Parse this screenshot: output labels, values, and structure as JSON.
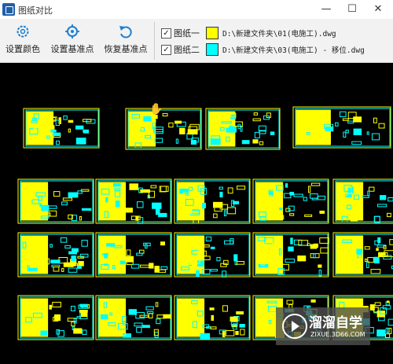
{
  "window": {
    "title": "图纸对比",
    "minimize": "—",
    "maximize": "☐",
    "close": "✕"
  },
  "toolbar": {
    "set_color": "设置颜色",
    "set_base": "设置基准点",
    "restore_base": "恢复基准点"
  },
  "drawings": [
    {
      "label": "图纸一",
      "checked": true,
      "color": "#ffff00",
      "path": "D:\\新建文件夹\\01(电施工).dwg"
    },
    {
      "label": "图纸二",
      "checked": true,
      "color": "#00ffff",
      "path": "D:\\新建文件夹\\03(电施工) - 移位.dwg"
    }
  ],
  "watermark": {
    "title": "溜溜自学",
    "sub": "ZIXUE.3D66.COM"
  },
  "colors": {
    "yellow": "#ffff00",
    "cyan": "#00ffff",
    "background": "#000000"
  }
}
